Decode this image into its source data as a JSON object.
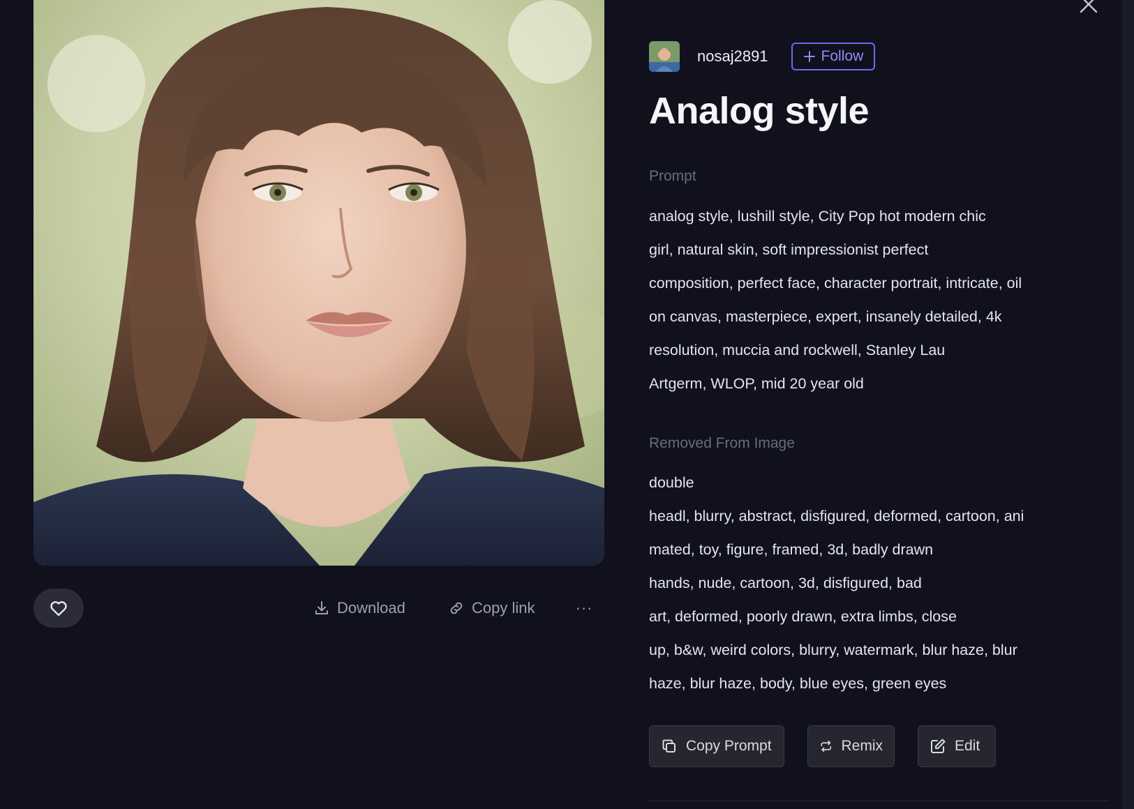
{
  "author": {
    "username": "nosaj2891",
    "follow_label": "Follow"
  },
  "post": {
    "title": "Analog style"
  },
  "prompt": {
    "label": "Prompt",
    "lines": [
      "analog style, lushill style, City Pop hot modern chic",
      "girl, natural skin, soft impressionist perfect",
      "composition, perfect face, character portrait, intricate, oil",
      "on canvas, masterpiece, expert, insanely detailed, 4k",
      "resolution, muccia and rockwell, Stanley Lau",
      "Artgerm, WLOP, mid 20 year old"
    ]
  },
  "removed": {
    "label": "Removed From Image",
    "lines": [
      "double",
      "headl, blurry, abstract, disfigured, deformed, cartoon, ani",
      "mated, toy, figure, framed, 3d, badly drawn",
      "hands, nude, cartoon, 3d, disfigured, bad",
      "art, deformed, poorly drawn, extra limbs, close",
      "up, b&w, weird colors, blurry, watermark, blur haze, blur",
      "haze, blur haze, body, blue eyes, green eyes"
    ]
  },
  "image_actions": {
    "download_label": "Download",
    "copy_link_label": "Copy link",
    "more_label": "···"
  },
  "actions": {
    "copy_prompt_label": "Copy Prompt",
    "remix_label": "Remix",
    "edit_label": "Edit"
  },
  "icons": {
    "like": "heart-icon",
    "download": "download-icon",
    "copy_link": "link-icon",
    "close": "close-icon",
    "follow": "plus-icon",
    "copy_prompt": "copy-icon",
    "remix": "repeat-icon",
    "edit": "edit-icon"
  },
  "colors": {
    "background": "#10111d",
    "accent": "#6d6bf0",
    "muted_text": "#6a6c7a"
  }
}
